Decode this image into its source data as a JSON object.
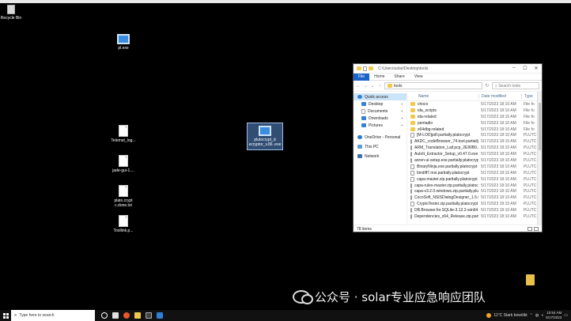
{
  "desktop": {
    "icons": [
      {
        "label": "Recycle Bin"
      },
      {
        "label": "pl.exe"
      },
      {
        "label": "Telemet_log..."
      },
      {
        "label": "jade-gui-1...."
      },
      {
        "label": "plato.crypt c.done.txt"
      },
      {
        "label": "Toollink.p..."
      },
      {
        "label": "plutocrypt_d ecryptor_v.86 .exe"
      }
    ]
  },
  "explorer": {
    "title": "C:\\Users\\solar\\Desktop\\tools",
    "ribbon_tabs": [
      "File",
      "Home",
      "Share",
      "View"
    ],
    "address_path": "tools",
    "search_placeholder": "Search tools",
    "nav": {
      "quick_access": "Quick access",
      "items": [
        "Desktop",
        "Documents",
        "Downloads",
        "Pictures"
      ],
      "onedrive": "OneDrive - Personal",
      "this_pc": "This PC",
      "network": "Network"
    },
    "columns": {
      "name": "Name",
      "date": "Date modified",
      "type": "Type"
    },
    "rows": [
      {
        "name": "choco",
        "date": "5/17/2023 18:10 AM",
        "type": "File fo",
        "kind": "folder"
      },
      {
        "name": "ida_scripts",
        "date": "5/17/2023 18:10 AM",
        "type": "File fo",
        "kind": "folder"
      },
      {
        "name": "ida-related",
        "date": "5/17/2023 18:10 AM",
        "type": "File fo",
        "kind": "folder"
      },
      {
        "name": "pentadio",
        "date": "5/17/2023 18:10 AM",
        "type": "File fo",
        "kind": "folder"
      },
      {
        "name": "x64dbg-related",
        "date": "5/17/2023 18:10 AM",
        "type": "File fo",
        "kind": "folder"
      },
      {
        "name": "[M-LOD]pdf.partially.platocrypt",
        "date": "5/17/2023 18:10 AM",
        "type": "PLUTC",
        "kind": "file"
      },
      {
        "name": "AKDC_codeBrowser_74.tool.partially.pl...",
        "date": "5/17/2023 18:10 AM",
        "type": "PLUTC",
        "kind": "file"
      },
      {
        "name": "ARM_Translation_Lall.pcp_2E90B0.zip.p...",
        "date": "5/17/2023 18:10 AM",
        "type": "PLUTC",
        "kind": "file"
      },
      {
        "name": "AutoIt_Extractor_Setup_v0.47.0.exe.parti...",
        "date": "5/17/2023 18:10 AM",
        "type": "PLUTC",
        "kind": "file"
      },
      {
        "name": "aoren-ui-setup.exe.partially.platocrypt",
        "date": "5/17/2023 18:10 AM",
        "type": "PLUTC",
        "kind": "file"
      },
      {
        "name": "BinaryNinja.exe.partially.platocrypt",
        "date": "5/17/2023 18:10 AM",
        "type": "PLUTC",
        "kind": "file"
      },
      {
        "name": "bindiff7.msi.partially.platocrypt",
        "date": "5/17/2023 18:10 AM",
        "type": "PLUTC",
        "kind": "file"
      },
      {
        "name": "capa-master.zip.partially.platocrypt",
        "date": "5/17/2023 18:10 AM",
        "type": "PLUTC",
        "kind": "file"
      },
      {
        "name": "capa-rules-master.zip.partially.platocrypt",
        "date": "5/17/2023 18:10 AM",
        "type": "PLUTC",
        "kind": "file"
      },
      {
        "name": "capa-v3.2.0-windows.zip.partially.plutocr...",
        "date": "5/17/2023 18:10 AM",
        "type": "PLUTC",
        "kind": "file"
      },
      {
        "name": "CocoSoft_NSISDialogDesigner_1.5.0.exe.p...",
        "date": "5/17/2023 18:10 AM",
        "type": "PLUTC",
        "kind": "file"
      },
      {
        "name": "CryptoTester.zip.partially.platocrypt",
        "date": "5/17/2023 18:10 AM",
        "type": "PLUTC",
        "kind": "file"
      },
      {
        "name": "DB.Browser.for.SQLite-3.12.2-win64.msi....",
        "date": "5/17/2023 18:10 AM",
        "type": "PLUTC",
        "kind": "file"
      },
      {
        "name": "Dependencies_x64_Release.zip.partially.pl...",
        "date": "5/17/2023 18:10 AM",
        "type": "PLUTC",
        "kind": "file"
      }
    ],
    "status": "78 items"
  },
  "taskbar": {
    "search_placeholder": "Type here to search",
    "weather": "11°C  Stark bewölkt",
    "time": "10:54 AM",
    "date": "5/17/2023"
  },
  "watermark": "公众号 · solar专业应急响应团队"
}
